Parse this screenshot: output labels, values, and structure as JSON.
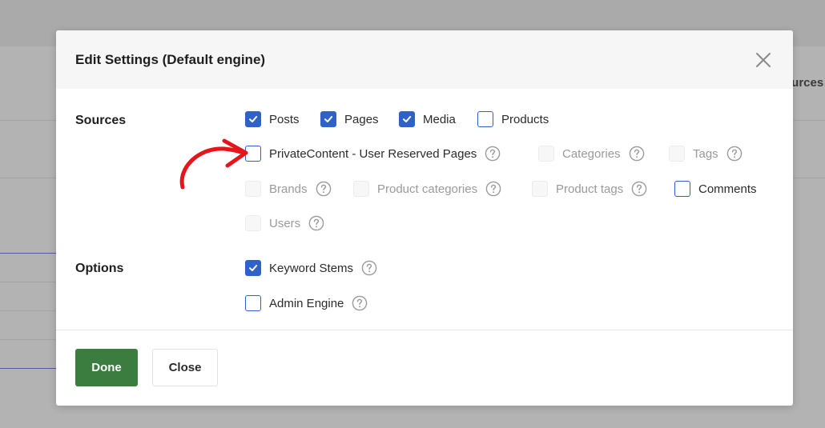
{
  "background": {
    "right_header_text": "Sources"
  },
  "modal": {
    "title": "Edit Settings (Default engine)",
    "close_icon": "close-icon",
    "sections": {
      "sources": {
        "label": "Sources",
        "rows": [
          [
            {
              "label": "Posts",
              "checked": true,
              "disabled": false,
              "help": false
            },
            {
              "label": "Pages",
              "checked": true,
              "disabled": false,
              "help": false
            },
            {
              "label": "Media",
              "checked": true,
              "disabled": false,
              "help": false
            },
            {
              "label": "Products",
              "checked": false,
              "disabled": false,
              "help": false
            }
          ],
          [
            {
              "label": "PrivateContent - User Reserved Pages",
              "checked": false,
              "disabled": false,
              "help": true
            },
            {
              "label": "Categories",
              "checked": false,
              "disabled": true,
              "help": true
            },
            {
              "label": "Tags",
              "checked": false,
              "disabled": true,
              "help": true
            }
          ],
          [
            {
              "label": "Brands",
              "checked": false,
              "disabled": true,
              "help": true
            },
            {
              "label": "Product categories",
              "checked": false,
              "disabled": true,
              "help": true
            },
            {
              "label": "Product tags",
              "checked": false,
              "disabled": true,
              "help": true
            },
            {
              "label": "Comments",
              "checked": false,
              "disabled": false,
              "help": false
            }
          ],
          [
            {
              "label": "Users",
              "checked": false,
              "disabled": true,
              "help": true
            }
          ]
        ]
      },
      "options": {
        "label": "Options",
        "rows": [
          [
            {
              "label": "Keyword Stems",
              "checked": true,
              "disabled": false,
              "help": true
            }
          ],
          [
            {
              "label": "Admin Engine",
              "checked": false,
              "disabled": false,
              "help": true
            }
          ]
        ]
      }
    },
    "footer": {
      "done_label": "Done",
      "close_label": "Close"
    }
  },
  "colors": {
    "accent": "#2f62c9",
    "done_button": "#3b7d3e",
    "annotation": "#e4151b"
  }
}
